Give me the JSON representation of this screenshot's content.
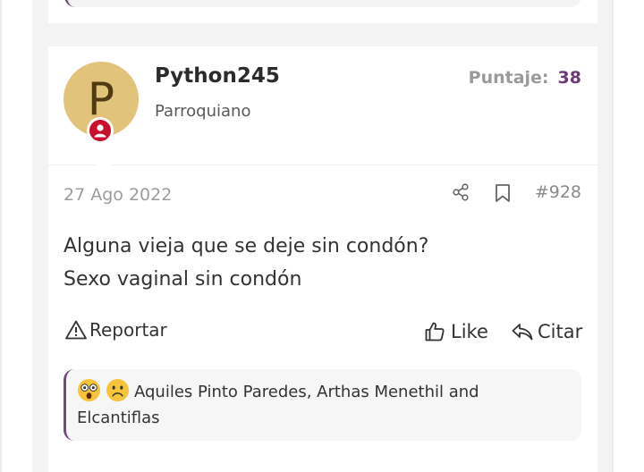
{
  "post": {
    "username": "Python245",
    "user_title": "Parroquiano",
    "avatar_letter": "P",
    "score_label": "Puntaje:",
    "score_value": "38",
    "date": "27 Ago 2022",
    "post_number": "#928",
    "content_line1": "Alguna vieja que se deje sin condón?",
    "content_line2": "Sexo vaginal sin condón"
  },
  "actions": {
    "report_label": "Reportar",
    "like_label": "Like",
    "quote_label": "Citar"
  },
  "reactions": {
    "emojis": [
      "astonished-emoji",
      "frowning-emoji"
    ],
    "users_text": "Aquiles Pinto Paredes, Arthas Menethil and Elcantiflas"
  },
  "colors": {
    "accent": "#6a3a7a",
    "avatar_bg": "#e1c37c",
    "badge_red": "#c8102e"
  }
}
